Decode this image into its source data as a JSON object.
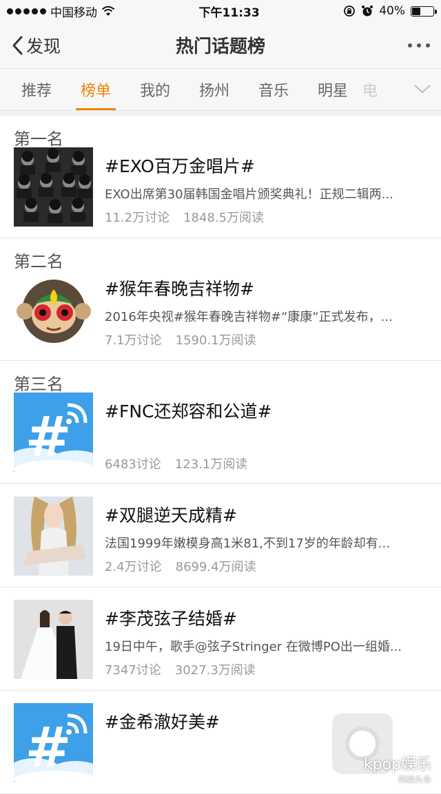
{
  "status_bar": {
    "carrier": "中国移动",
    "time": "下午11:33",
    "battery": "40%",
    "battery_level": 0.4
  },
  "navbar": {
    "back_label": "发现",
    "title": "热门话题榜"
  },
  "tabs": [
    {
      "label": "推荐",
      "active": false
    },
    {
      "label": "榜单",
      "active": true
    },
    {
      "label": "我的",
      "active": false
    },
    {
      "label": "扬州",
      "active": false
    },
    {
      "label": "音乐",
      "active": false
    },
    {
      "label": "明星",
      "active": false
    },
    {
      "label": "电",
      "active": false
    }
  ],
  "topics": [
    {
      "rank": "第一名",
      "title": "#EXO百万金唱片#",
      "desc": "EXO出席第30届韩国金唱片颁奖典礼！正规二辑两...",
      "discussions": "11.2万讨论",
      "reads": "1848.5万阅读",
      "thumb": "group-photo"
    },
    {
      "rank": "第二名",
      "title": "#猴年春晚吉祥物#",
      "desc": "2016年央视#猴年春晚吉祥物#“康康“正式发布，...",
      "discussions": "7.1万讨论",
      "reads": "1590.1万阅读",
      "thumb": "monkey-mascot"
    },
    {
      "rank": "第三名",
      "title": "#FNC还郑容和公道#",
      "desc": "",
      "discussions": "6483讨论",
      "reads": "123.1万阅读",
      "thumb": "hashtag-default"
    },
    {
      "rank": "",
      "title": "#双腿逆天成精#",
      "desc": "法国1999年嫩模身高1米81,不到17岁的年龄却有...",
      "discussions": "2.4万讨论",
      "reads": "8699.4万阅读",
      "thumb": "model-photo"
    },
    {
      "rank": "",
      "title": "#李茂弦子结婚#",
      "desc": "19日中午，歌手@弦子Stringer 在微博PO出一组婚...",
      "discussions": "7347讨论",
      "reads": "3027.3万阅读",
      "thumb": "wedding-photo"
    },
    {
      "rank": "",
      "title": "#金希澈好美#",
      "desc": "",
      "discussions": "",
      "reads": "",
      "thumb": "hashtag-default"
    }
  ],
  "watermark": {
    "text": "kpop娱乐",
    "sub": "韩娱头条"
  },
  "colors": {
    "accent": "#f08300",
    "hashtag_blue": "#4aa3e8"
  }
}
